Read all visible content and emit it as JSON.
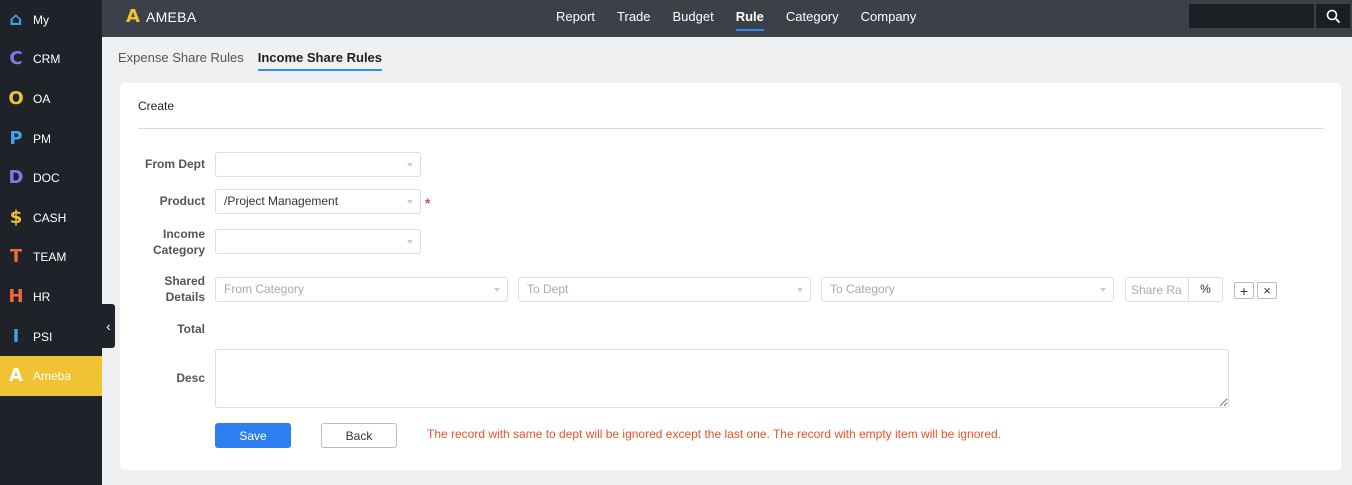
{
  "sidebar": {
    "items": [
      {
        "icon": "home-icon",
        "glyph": "⌂",
        "color": "#3ea6e6",
        "label": "My"
      },
      {
        "icon": "crm-letter-icon",
        "glyph": "C",
        "color": "#8b74e8",
        "label": "CRM"
      },
      {
        "icon": "oa-circle-icon",
        "glyph": "O",
        "color": "#f1c232",
        "label": "OA"
      },
      {
        "icon": "pm-letter-icon",
        "glyph": "P",
        "color": "#3ea6e6",
        "label": "PM"
      },
      {
        "icon": "doc-letter-icon",
        "glyph": "D",
        "color": "#8b74e8",
        "label": "DOC"
      },
      {
        "icon": "dollar-icon",
        "glyph": "$",
        "color": "#f1c232",
        "label": "CASH"
      },
      {
        "icon": "team-letter-icon",
        "glyph": "T",
        "color": "#f06a3a",
        "label": "TEAM"
      },
      {
        "icon": "hr-letter-icon",
        "glyph": "H",
        "color": "#f06a3a",
        "label": "HR"
      },
      {
        "icon": "psi-bar-icon",
        "glyph": "I",
        "color": "#3ea6e6",
        "label": "PSI"
      },
      {
        "icon": "ameba-letter-icon",
        "glyph": "A",
        "color": "#ffffff",
        "label": "Ameba"
      }
    ],
    "active_index": 9
  },
  "header": {
    "brand_mark": "A",
    "brand_name": "AMEBA",
    "nav": [
      "Report",
      "Trade",
      "Budget",
      "Rule",
      "Category",
      "Company"
    ],
    "active_nav": 3,
    "search_value": ""
  },
  "subtabs": [
    "Expense Share Rules",
    "Income Share Rules"
  ],
  "active_subtab": 1,
  "form": {
    "title": "Create",
    "from_dept_label": "From Dept",
    "from_dept_value": "",
    "product_label": "Product",
    "product_value": "/Project Management",
    "required_mark": "*",
    "income_category_label": "Income Category",
    "income_category_value": "",
    "shared_details_label": "Shared Details",
    "from_category_placeholder": "From Category",
    "to_dept_placeholder": "To Dept",
    "to_category_placeholder": "To Category",
    "share_rate_placeholder": "Share Ra",
    "percent_addon": "%",
    "add_glyph": "+",
    "remove_glyph": "×",
    "total_label": "Total",
    "desc_label": "Desc",
    "save_label": "Save",
    "back_label": "Back",
    "notice": "The record with same to dept will be ignored except the last one. The record with empty item will be ignored."
  },
  "colors": {
    "accent": "#2d7ff0",
    "sidebar_active": "#f1c232",
    "notice": "#e8542a"
  }
}
